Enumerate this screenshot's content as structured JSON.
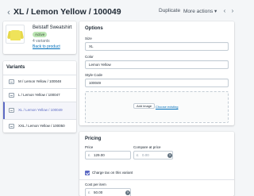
{
  "header": {
    "title": "XL / Lemon Yellow / 100049",
    "back_icon": "chevron-left-icon",
    "duplicate_label": "Duplicate",
    "more_actions_label": "More actions ▾",
    "prev_icon": "chevron-left-icon",
    "next_icon": "chevron-right-icon"
  },
  "product": {
    "name": "Belstaff Sweatshirt",
    "status": "Active",
    "variant_count": "4 variants",
    "back_link": "Back to product"
  },
  "variants": {
    "heading": "Variants",
    "items": [
      {
        "label": "M / Lemon Yellow / 100048",
        "active": false
      },
      {
        "label": "L / Lemon Yellow / 100047",
        "active": false
      },
      {
        "label": "XL / Lemon Yellow / 100049",
        "active": true
      },
      {
        "label": "XXL / Lemon Yellow / 100050",
        "active": false
      }
    ]
  },
  "options": {
    "heading": "Options",
    "fields": [
      {
        "label": "Size",
        "value": "XL"
      },
      {
        "label": "Color",
        "value": "Lemon Yellow"
      },
      {
        "label": "Style Code",
        "value": "100049"
      }
    ],
    "add_image_label": "Add image",
    "choose_existing_label": "Choose existing"
  },
  "pricing": {
    "heading": "Pricing",
    "price_label": "Price",
    "currency_symbol": "£",
    "price_value": "129.00",
    "compare_label": "Compare at price",
    "compare_placeholder": "0.00",
    "charge_tax_label": "Charge tax on this variant",
    "charge_tax_checked": true,
    "cost_label": "Cost per item",
    "cost_value": "50.00"
  },
  "colors": {
    "accent": "#5c6ac4",
    "link": "#006fbb",
    "badge_bg": "#bbe5b3",
    "background": "#f4f6f8"
  }
}
